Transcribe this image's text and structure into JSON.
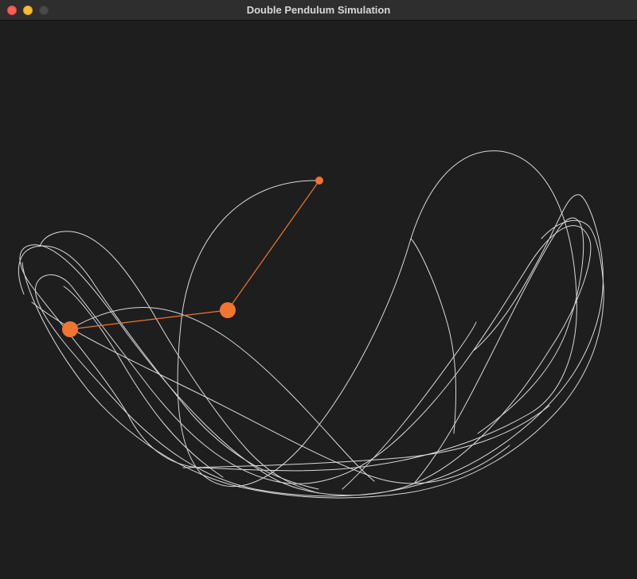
{
  "window": {
    "title": "Double Pendulum Simulation"
  },
  "colors": {
    "background": "#1e1e1e",
    "titlebar": "#2e2e2e",
    "trail": "#d9d9d9",
    "pendulum": "#f07530"
  },
  "icons": {
    "close": "close-traffic-light-icon",
    "minimize": "minimize-traffic-light-icon",
    "maximize": "maximize-traffic-light-icon"
  }
}
